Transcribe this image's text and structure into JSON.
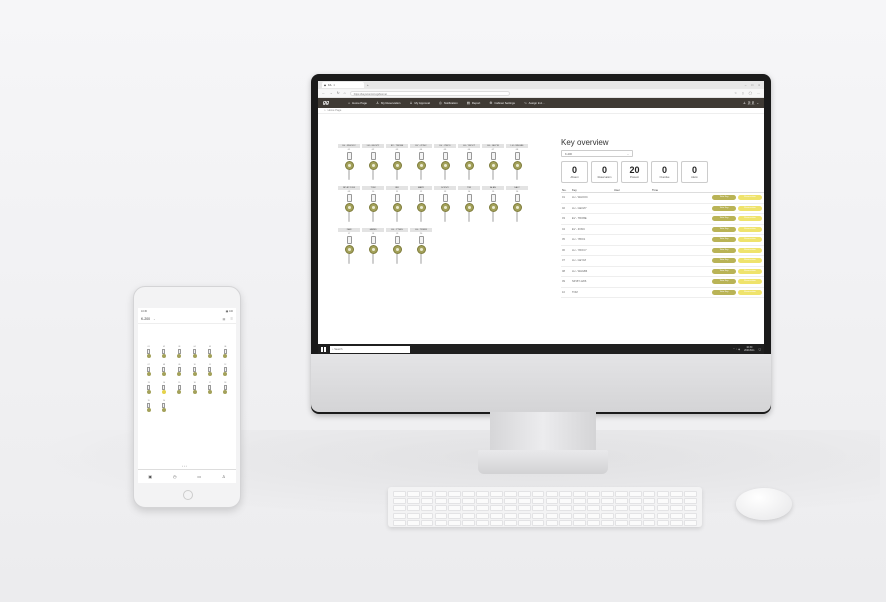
{
  "browser": {
    "tab_title": "KA",
    "url": "https://keyscontrol.cgi/Home/",
    "window_controls": [
      "–",
      "□",
      "×"
    ]
  },
  "app": {
    "logo": "gg",
    "menu": [
      {
        "icon": "home-icon",
        "glyph": "⌂",
        "label": "Home Page"
      },
      {
        "icon": "user-icon",
        "glyph": "♙",
        "label": "My Reservation"
      },
      {
        "icon": "check-user-icon",
        "glyph": "♙",
        "label": "My Approval"
      },
      {
        "icon": "bell-icon",
        "glyph": "◎",
        "label": "Notification"
      },
      {
        "icon": "report-icon",
        "glyph": "▤",
        "label": "Report"
      },
      {
        "icon": "gear-icon",
        "glyph": "⚙",
        "label": "Cabinet Settings"
      },
      {
        "icon": "assign-icon",
        "glyph": "⤳",
        "label": "Assign Invi..."
      }
    ],
    "user_label": "贝 贝",
    "breadcrumb": "Home Page"
  },
  "cabinet_rows": [
    [
      {
        "label": "LH - WHOOC",
        "num": "01"
      },
      {
        "label": "LH - GEOZY",
        "num": "02"
      },
      {
        "label": "EV - TROBE",
        "num": "03"
      },
      {
        "label": "EV - ZONC",
        "num": "04"
      },
      {
        "label": "LH - YBIO1",
        "num": "05"
      },
      {
        "label": "LH - YROC7",
        "num": "06"
      },
      {
        "label": "LH - GEY18",
        "num": "07"
      },
      {
        "label": "LH - WHGB6",
        "num": "08"
      }
    ],
    [
      {
        "label": "NP-BT-1206",
        "num": "09"
      },
      {
        "label": "TOM",
        "num": "10"
      },
      {
        "label": "JAY",
        "num": "11"
      },
      {
        "label": "MARY",
        "num": "12"
      },
      {
        "label": "SOPHY",
        "num": "13"
      },
      {
        "label": "TIM",
        "num": "14"
      },
      {
        "label": "ALAN",
        "num": "15"
      },
      {
        "label": "SALY",
        "num": "16"
      }
    ],
    [
      {
        "label": "DAN",
        "num": "17"
      },
      {
        "label": "JAMES",
        "num": "18"
      },
      {
        "label": "LH - YTSE5",
        "num": "19"
      },
      {
        "label": "LH - TRSB3",
        "num": "20"
      }
    ]
  ],
  "overview": {
    "title": "Key overview",
    "cabinet_select": "K-200",
    "stats": [
      {
        "value": "0",
        "label": "Absent"
      },
      {
        "value": "0",
        "label": "Reservation"
      },
      {
        "value": "20",
        "label": "Present"
      },
      {
        "value": "0",
        "label": "Overdue"
      },
      {
        "value": "0",
        "label": "Alarm"
      }
    ],
    "columns": [
      "No.",
      "Key",
      "User",
      "Time"
    ],
    "take_label": "Take Key",
    "reserve_label": "Reservation",
    "rows": [
      {
        "no": "01",
        "key": "LH - WHOOC"
      },
      {
        "no": "02",
        "key": "LH - GEOZY"
      },
      {
        "no": "03",
        "key": "EV - TROBE"
      },
      {
        "no": "04",
        "key": "EV - ZONC"
      },
      {
        "no": "05",
        "key": "LH - YBIO1"
      },
      {
        "no": "06",
        "key": "LH - YROC7"
      },
      {
        "no": "07",
        "key": "LH - GEY18"
      },
      {
        "no": "08",
        "key": "LH - WHGB6"
      },
      {
        "no": "09",
        "key": "NP-BT-1206"
      },
      {
        "no": "10",
        "key": "TOM"
      }
    ]
  },
  "taskbar": {
    "search_placeholder": "Search",
    "time": "10:30",
    "date": "2021/8/11"
  },
  "phone": {
    "status_time": "10:30",
    "status_right": "▮▮ 100",
    "title": "K-200",
    "nav": [
      {
        "icon": "cabinet-icon",
        "glyph": "▣"
      },
      {
        "icon": "clock-icon",
        "glyph": "◷"
      },
      {
        "icon": "chat-icon",
        "glyph": "▭"
      },
      {
        "icon": "user-icon",
        "glyph": "♙"
      }
    ],
    "slots": [
      {
        "label": "01",
        "alert": false
      },
      {
        "label": "02",
        "alert": false
      },
      {
        "label": "03",
        "alert": false
      },
      {
        "label": "04",
        "alert": false
      },
      {
        "label": "05",
        "alert": false
      },
      {
        "label": "06",
        "alert": false
      },
      {
        "label": "07",
        "alert": false
      },
      {
        "label": "08",
        "alert": false
      },
      {
        "label": "09",
        "alert": false
      },
      {
        "label": "10",
        "alert": false
      },
      {
        "label": "11",
        "alert": false
      },
      {
        "label": "12",
        "alert": false
      },
      {
        "label": "13",
        "alert": false
      },
      {
        "label": "14",
        "alert": true
      },
      {
        "label": "15",
        "alert": false
      },
      {
        "label": "16",
        "alert": false
      },
      {
        "label": "17",
        "alert": false
      },
      {
        "label": "18",
        "alert": false
      },
      {
        "label": "19",
        "alert": false
      },
      {
        "label": "20",
        "alert": false
      }
    ]
  },
  "colors": {
    "header_bg": "#3f3a34",
    "fob_olive": "#a3a15a",
    "take_button": "#b9b356",
    "reserve_button": "#efe36c"
  }
}
